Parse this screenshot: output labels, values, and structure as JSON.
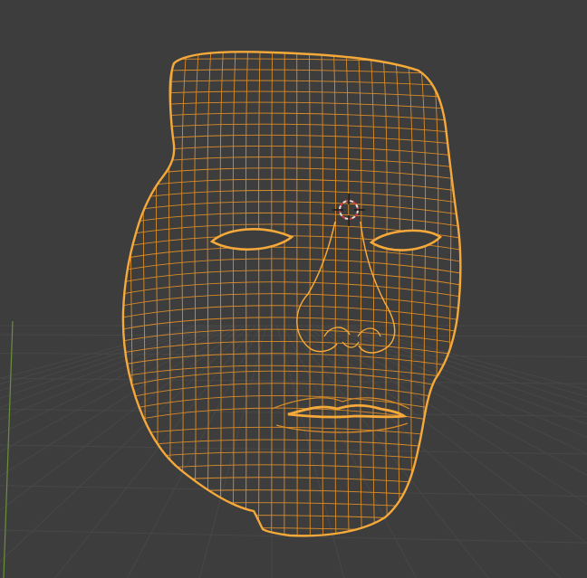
{
  "viewport": {
    "mode": "wireframe",
    "background_color": "#3d3d3d",
    "grid_color": "#474747",
    "y_axis_color": "#6a8e3c"
  },
  "mesh": {
    "object": "face",
    "state": "selected",
    "wire_color": "#d98b28",
    "outline_color": "#f5a93a"
  },
  "cursor": {
    "icon": "3d-cursor-icon",
    "ring_colors": [
      "#e0e0e0",
      "#d23c3c"
    ]
  }
}
